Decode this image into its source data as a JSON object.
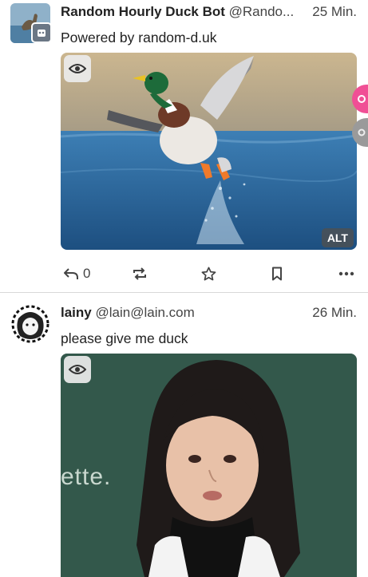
{
  "posts": [
    {
      "name": "Random Hourly Duck Bot",
      "handle": "@Rando...",
      "time": "25 Min.",
      "text": "Powered by random-d.uk",
      "media_alt_badge": "ALT",
      "actions": {
        "reply_count": "0"
      }
    },
    {
      "name": "lainy",
      "handle": "@lain@lain.com",
      "time": "26 Min.",
      "text": "please give me duck",
      "media_overlay_text": "ette."
    }
  ],
  "colors": {
    "accent_pink": "#f04f95",
    "divider": "#d9d9d9"
  },
  "icons": [
    "eye-icon",
    "reply-icon",
    "boost-icon",
    "star-icon",
    "bookmark-icon",
    "more-icon",
    "bot-icon"
  ]
}
